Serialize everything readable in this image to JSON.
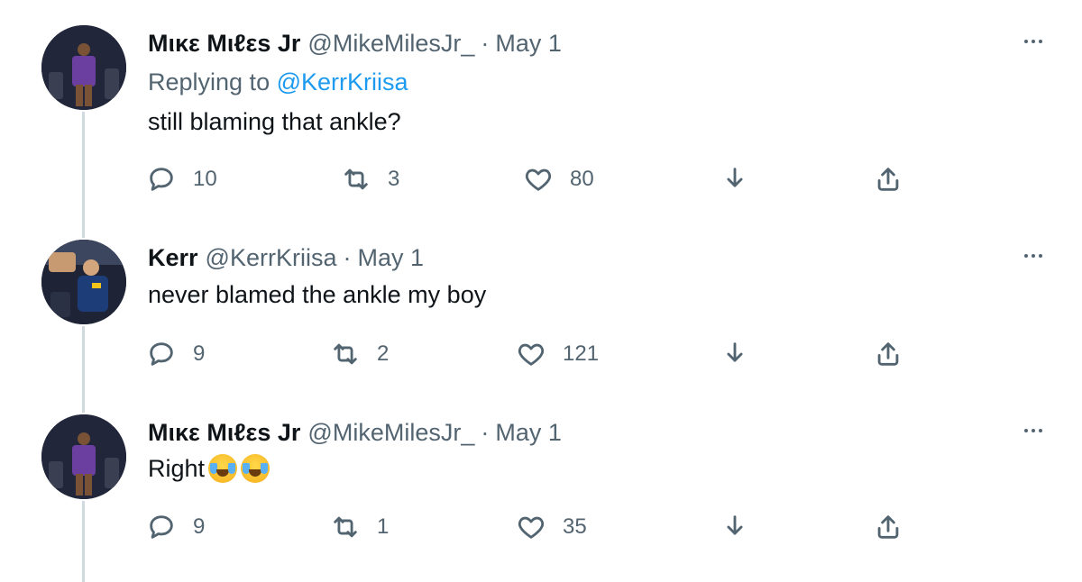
{
  "tweets": [
    {
      "display_name": "Mικε Mιℓεs Jr",
      "handle": "@MikeMilesJr_",
      "separator": "·",
      "date": "May 1",
      "replying_prefix": "Replying to",
      "replying_to": "@KerrKriisa",
      "text": "still blaming that ankle?",
      "avatar": "player-avatar",
      "stats": {
        "replies": "10",
        "retweets": "3",
        "likes": "80"
      }
    },
    {
      "display_name": "Kerr",
      "handle": "@KerrKriisa",
      "separator": "·",
      "date": "May 1",
      "text": "never blamed the ankle my boy",
      "avatar": "player-avatar",
      "stats": {
        "replies": "9",
        "retweets": "2",
        "likes": "121"
      }
    },
    {
      "display_name": "Mικε Mιℓεs Jr",
      "handle": "@MikeMilesJr_",
      "separator": "·",
      "date": "May 1",
      "text": "Right",
      "emojis": [
        "face-with-tears-of-joy",
        "face-with-tears-of-joy"
      ],
      "avatar": "player-avatar",
      "stats": {
        "replies": "9",
        "retweets": "1",
        "likes": "35"
      }
    }
  ],
  "icons": [
    "reply-icon",
    "retweet-icon",
    "like-icon",
    "download-icon",
    "share-icon",
    "more-icon"
  ],
  "colors": {
    "link": "#1d9bf0",
    "secondary_text": "#536471",
    "primary_text": "#0f1419",
    "thread_line": "#cfd9de"
  }
}
